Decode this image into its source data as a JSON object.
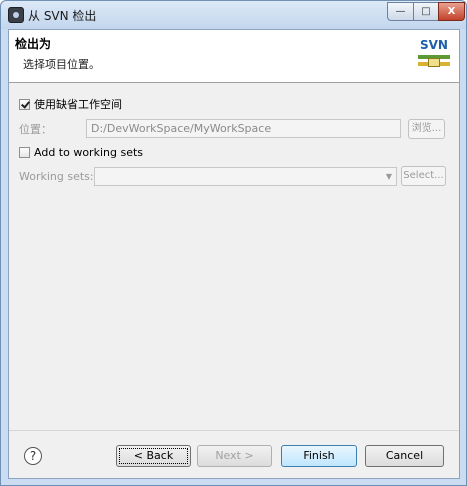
{
  "window": {
    "title": "从 SVN 检出",
    "min_label": "—",
    "max_label": "□",
    "close_label": "X"
  },
  "header": {
    "title": "检出为",
    "description": "选择项目位置。",
    "logo_text": "SVN"
  },
  "workspace": {
    "use_default_label": "使用缺省工作空间",
    "use_default_checked": true
  },
  "location": {
    "label": "位置：",
    "value": "D:/DevWorkSpace/MyWorkSpace",
    "browse_label": "浏览..."
  },
  "working_sets": {
    "add_label": "Add to working sets",
    "add_checked": false,
    "label": "Working sets:",
    "value": "",
    "select_label": "Select..."
  },
  "footer": {
    "help_label": "?",
    "back_label": "< Back",
    "next_label": "Next >",
    "finish_label": "Finish",
    "cancel_label": "Cancel"
  }
}
